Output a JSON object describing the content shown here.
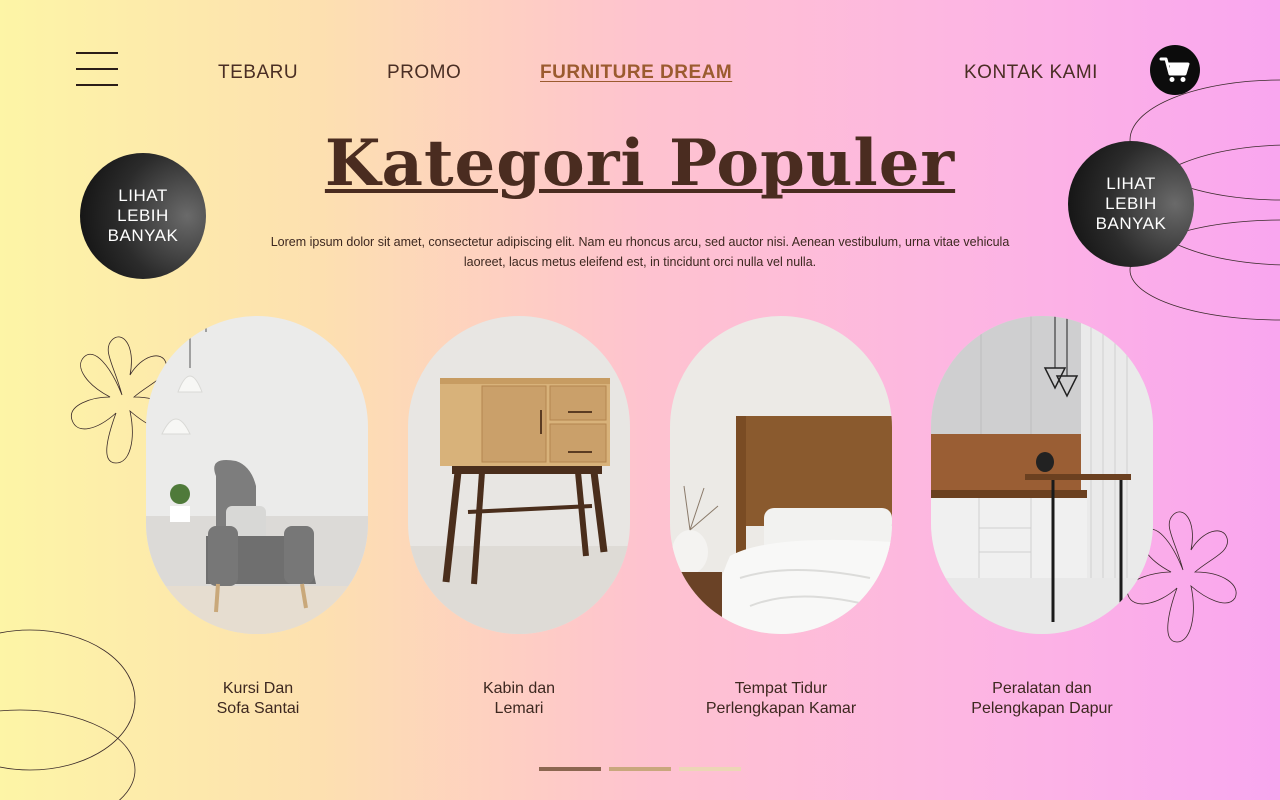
{
  "nav": {
    "items": [
      "TEBARU",
      "PROMO",
      "FURNITURE DREAM",
      "KONTAK KAMI"
    ],
    "active": "FURNITURE DREAM"
  },
  "icons": {
    "menu": "hamburger-menu-icon",
    "cart": "shopping-cart-icon"
  },
  "hero": {
    "title": "Kategori Populer",
    "subtitle": "Lorem ipsum dolor sit amet, consectetur adipiscing elit. Nam eu rhoncus arcu, sed auctor nisi. Aenean vestibulum, urna vitae vehicula laoreet, lacus metus eleifend est, in tincidunt orci nulla vel nulla."
  },
  "cta": {
    "left": "LIHAT LEBIH BANYAK",
    "right": "LIHAT LEBIH BANYAK"
  },
  "categories": [
    {
      "label": "Kursi Dan\nSofa Santai",
      "image": "armchair-photo"
    },
    {
      "label": "Kabin dan\nLemari",
      "image": "wooden-cabinet-photo"
    },
    {
      "label": "Tempat Tidur\nPerlengkapan Kamar",
      "image": "bed-photo"
    },
    {
      "label": "Peralatan dan\nPelengkapan Dapur",
      "image": "kitchen-photo"
    }
  ],
  "pagination": {
    "pages": 3,
    "active": 1
  },
  "colors": {
    "accent": "#9b5b2f",
    "text": "#3d2820",
    "dark": "#0c0c0c",
    "dot_active": "#8b6650",
    "dot_mid": "#c9a77d",
    "dot_light": "#ecd6b6"
  }
}
